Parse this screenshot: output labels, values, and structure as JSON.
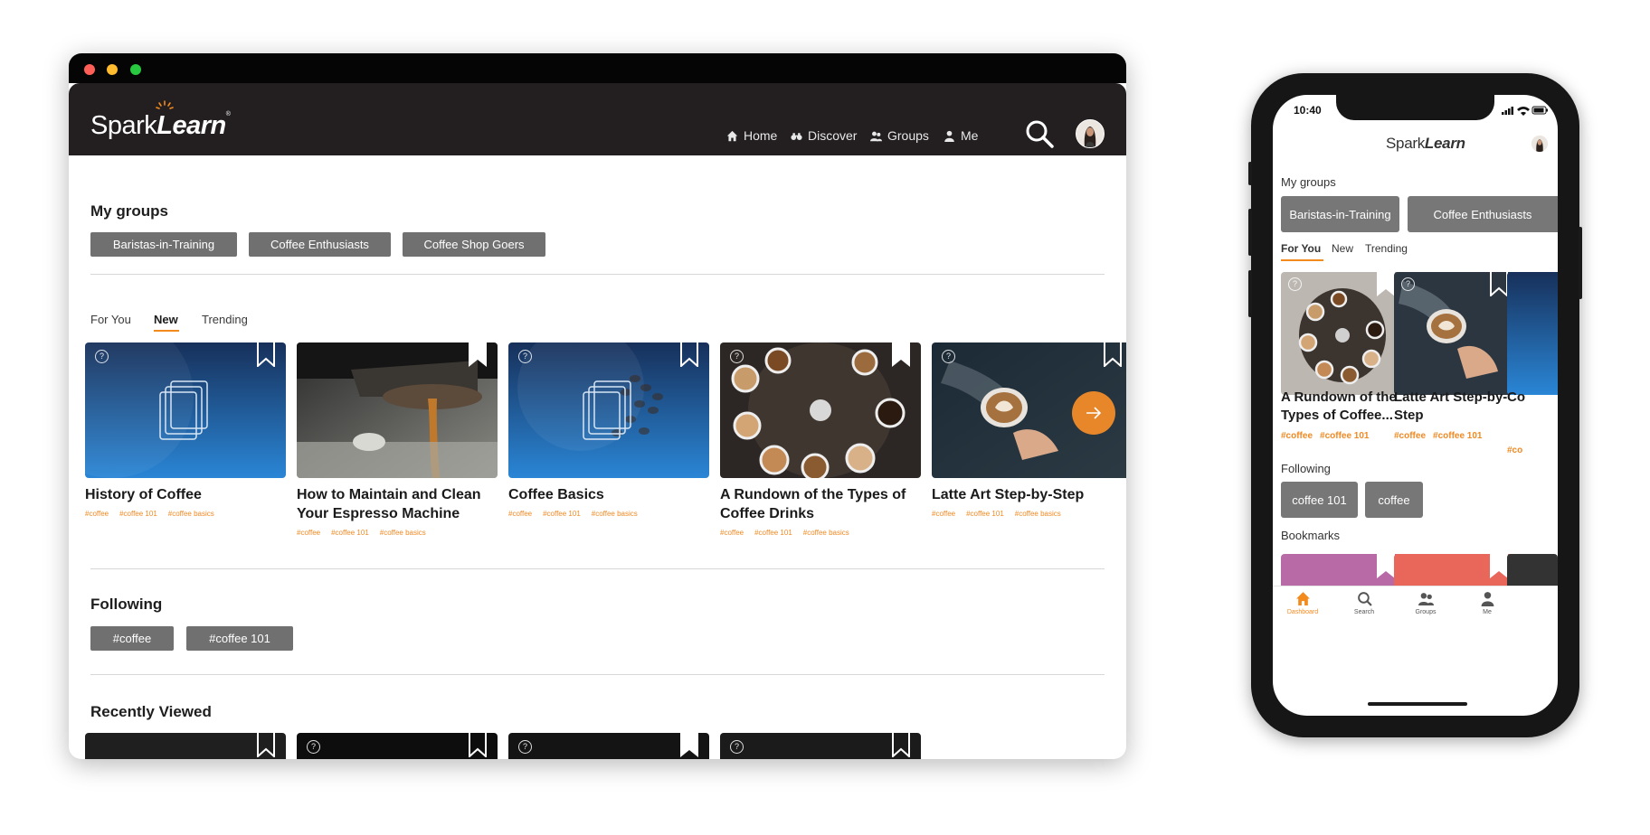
{
  "desktop": {
    "brand": {
      "text_regular": "Spark",
      "text_bold": "Learn"
    },
    "nav": [
      {
        "label": "Home",
        "icon": "home-icon"
      },
      {
        "label": "Discover",
        "icon": "binoculars-icon"
      },
      {
        "label": "Groups",
        "icon": "groups-icon"
      },
      {
        "label": "Me",
        "icon": "person-icon"
      }
    ],
    "my_groups": {
      "title": "My groups",
      "chips": [
        "Baristas-in-Training",
        "Coffee Enthusiasts",
        "Coffee Shop Goers"
      ]
    },
    "tabs": [
      {
        "label": "For You",
        "active": false
      },
      {
        "label": "New",
        "active": true
      },
      {
        "label": "Trending",
        "active": false
      }
    ],
    "cards": [
      {
        "title": "History of Coffee",
        "tags": [
          "#coffee",
          "#coffee 101",
          "#coffee basics"
        ],
        "thumb": "blue-placeholder"
      },
      {
        "title": "How to Maintain and Clean Your Espresso Machine",
        "tags": [
          "#coffee",
          "#coffee 101",
          "#coffee basics"
        ],
        "thumb": "espresso-photo"
      },
      {
        "title": "Coffee Basics",
        "tags": [
          "#coffee",
          "#coffee 101",
          "#coffee basics"
        ],
        "thumb": "blue-placeholder"
      },
      {
        "title": "A Rundown of the Types of Coffee Drinks",
        "tags": [
          "#coffee",
          "#coffee 101",
          "#coffee basics"
        ],
        "thumb": "coffee-table-photo"
      },
      {
        "title": "Latte Art Step-by-Step",
        "tags": [
          "#coffee",
          "#coffee 101",
          "#coffee basics"
        ],
        "thumb": "latte-art-photo"
      }
    ],
    "following": {
      "title": "Following",
      "chips": [
        "#coffee",
        "#coffee 101"
      ]
    },
    "recently_viewed": {
      "title": "Recently Viewed"
    }
  },
  "mobile": {
    "status_time": "10:40",
    "brand": {
      "text_regular": "Spark",
      "text_bold": "Learn"
    },
    "my_groups": {
      "title": "My groups",
      "chips": [
        "Baristas-in-Training",
        "Coffee Enthusiasts"
      ]
    },
    "tabs": [
      {
        "label": "For You",
        "active": true
      },
      {
        "label": "New",
        "active": false
      },
      {
        "label": "Trending",
        "active": false
      }
    ],
    "cards": [
      {
        "title": "A Rundown of the Types of Coffee...",
        "tags": [
          "#coffee",
          "#coffee 101"
        ]
      },
      {
        "title": "Latte Art Step-by-Step",
        "tags": [
          "#coffee",
          "#coffee 101"
        ]
      },
      {
        "title": "Co",
        "tags": [
          "#co"
        ]
      }
    ],
    "following": {
      "title": "Following",
      "chips": [
        "coffee 101",
        "coffee"
      ]
    },
    "bookmarks": {
      "title": "Bookmarks"
    },
    "tabbar": [
      {
        "label": "Dashboard",
        "icon": "home-icon",
        "active": true
      },
      {
        "label": "Search",
        "icon": "search-icon",
        "active": false
      },
      {
        "label": "Groups",
        "icon": "groups-icon",
        "active": false
      },
      {
        "label": "Me",
        "icon": "person-icon",
        "active": false
      }
    ]
  },
  "colors": {
    "accent": "#f28a1e",
    "header": "#231f20",
    "chip": "#707070"
  }
}
